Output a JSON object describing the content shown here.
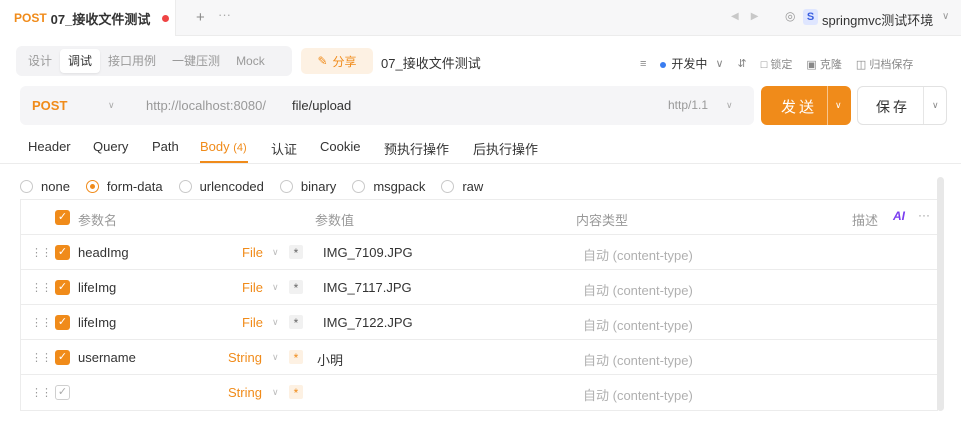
{
  "tab": {
    "method": "POST",
    "title": "07_接收文件测试",
    "plus": "+",
    "more": "···"
  },
  "env": {
    "badge": "S",
    "name": "springmvc测试环境"
  },
  "subbar": {
    "segments": [
      "设计",
      "调试",
      "接口用例",
      "一键压测",
      "Mock"
    ],
    "share": "分享",
    "api_name": "07_接收文件测试",
    "status": "开发中",
    "lock": "锁定",
    "clone": "克隆",
    "archive": "归档保存"
  },
  "request": {
    "method": "POST",
    "base_url": "http://localhost:8080/",
    "path": "file/upload",
    "protocol": "http/1.1",
    "send": "发送",
    "save": "保存"
  },
  "req_tabs": [
    {
      "label": "Header"
    },
    {
      "label": "Query"
    },
    {
      "label": "Path"
    },
    {
      "label": "Body",
      "count": "(4)"
    },
    {
      "label": "认证"
    },
    {
      "label": "Cookie"
    },
    {
      "label": "预执行操作"
    },
    {
      "label": "后执行操作"
    }
  ],
  "body_types": [
    "none",
    "form-data",
    "urlencoded",
    "binary",
    "msgpack",
    "raw"
  ],
  "body_type_selected": "form-data",
  "table": {
    "headers": {
      "name": "参数名",
      "value": "参数值",
      "content_type": "内容类型",
      "desc": "描述",
      "ai": "AI",
      "more": "···"
    },
    "rows": [
      {
        "name": "headImg",
        "type": "File",
        "value": "IMG_7109.JPG",
        "content_type": "自动 (content-type)"
      },
      {
        "name": "lifeImg",
        "type": "File",
        "value": "IMG_7117.JPG",
        "content_type": "自动 (content-type)"
      },
      {
        "name": "lifeImg",
        "type": "File",
        "value": "IMG_7122.JPG",
        "content_type": "自动 (content-type)"
      },
      {
        "name": "username",
        "type": "String",
        "value": "小明",
        "content_type": "自动 (content-type)"
      },
      {
        "name": "",
        "type": "String",
        "value": "",
        "content_type": "自动 (content-type)"
      }
    ]
  }
}
